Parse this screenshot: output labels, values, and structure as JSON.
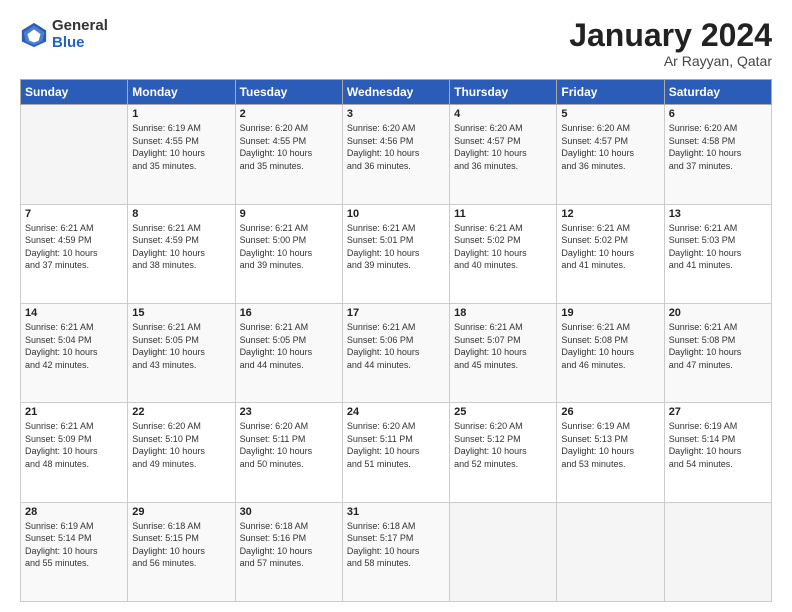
{
  "header": {
    "logo_line1": "General",
    "logo_line2": "Blue",
    "title": "January 2024",
    "subtitle": "Ar Rayyan, Qatar"
  },
  "weekdays": [
    "Sunday",
    "Monday",
    "Tuesday",
    "Wednesday",
    "Thursday",
    "Friday",
    "Saturday"
  ],
  "weeks": [
    [
      {
        "num": "",
        "info": ""
      },
      {
        "num": "1",
        "info": "Sunrise: 6:19 AM\nSunset: 4:55 PM\nDaylight: 10 hours\nand 35 minutes."
      },
      {
        "num": "2",
        "info": "Sunrise: 6:20 AM\nSunset: 4:55 PM\nDaylight: 10 hours\nand 35 minutes."
      },
      {
        "num": "3",
        "info": "Sunrise: 6:20 AM\nSunset: 4:56 PM\nDaylight: 10 hours\nand 36 minutes."
      },
      {
        "num": "4",
        "info": "Sunrise: 6:20 AM\nSunset: 4:57 PM\nDaylight: 10 hours\nand 36 minutes."
      },
      {
        "num": "5",
        "info": "Sunrise: 6:20 AM\nSunset: 4:57 PM\nDaylight: 10 hours\nand 36 minutes."
      },
      {
        "num": "6",
        "info": "Sunrise: 6:20 AM\nSunset: 4:58 PM\nDaylight: 10 hours\nand 37 minutes."
      }
    ],
    [
      {
        "num": "7",
        "info": "Sunrise: 6:21 AM\nSunset: 4:59 PM\nDaylight: 10 hours\nand 37 minutes."
      },
      {
        "num": "8",
        "info": "Sunrise: 6:21 AM\nSunset: 4:59 PM\nDaylight: 10 hours\nand 38 minutes."
      },
      {
        "num": "9",
        "info": "Sunrise: 6:21 AM\nSunset: 5:00 PM\nDaylight: 10 hours\nand 39 minutes."
      },
      {
        "num": "10",
        "info": "Sunrise: 6:21 AM\nSunset: 5:01 PM\nDaylight: 10 hours\nand 39 minutes."
      },
      {
        "num": "11",
        "info": "Sunrise: 6:21 AM\nSunset: 5:02 PM\nDaylight: 10 hours\nand 40 minutes."
      },
      {
        "num": "12",
        "info": "Sunrise: 6:21 AM\nSunset: 5:02 PM\nDaylight: 10 hours\nand 41 minutes."
      },
      {
        "num": "13",
        "info": "Sunrise: 6:21 AM\nSunset: 5:03 PM\nDaylight: 10 hours\nand 41 minutes."
      }
    ],
    [
      {
        "num": "14",
        "info": "Sunrise: 6:21 AM\nSunset: 5:04 PM\nDaylight: 10 hours\nand 42 minutes."
      },
      {
        "num": "15",
        "info": "Sunrise: 6:21 AM\nSunset: 5:05 PM\nDaylight: 10 hours\nand 43 minutes."
      },
      {
        "num": "16",
        "info": "Sunrise: 6:21 AM\nSunset: 5:05 PM\nDaylight: 10 hours\nand 44 minutes."
      },
      {
        "num": "17",
        "info": "Sunrise: 6:21 AM\nSunset: 5:06 PM\nDaylight: 10 hours\nand 44 minutes."
      },
      {
        "num": "18",
        "info": "Sunrise: 6:21 AM\nSunset: 5:07 PM\nDaylight: 10 hours\nand 45 minutes."
      },
      {
        "num": "19",
        "info": "Sunrise: 6:21 AM\nSunset: 5:08 PM\nDaylight: 10 hours\nand 46 minutes."
      },
      {
        "num": "20",
        "info": "Sunrise: 6:21 AM\nSunset: 5:08 PM\nDaylight: 10 hours\nand 47 minutes."
      }
    ],
    [
      {
        "num": "21",
        "info": "Sunrise: 6:21 AM\nSunset: 5:09 PM\nDaylight: 10 hours\nand 48 minutes."
      },
      {
        "num": "22",
        "info": "Sunrise: 6:20 AM\nSunset: 5:10 PM\nDaylight: 10 hours\nand 49 minutes."
      },
      {
        "num": "23",
        "info": "Sunrise: 6:20 AM\nSunset: 5:11 PM\nDaylight: 10 hours\nand 50 minutes."
      },
      {
        "num": "24",
        "info": "Sunrise: 6:20 AM\nSunset: 5:11 PM\nDaylight: 10 hours\nand 51 minutes."
      },
      {
        "num": "25",
        "info": "Sunrise: 6:20 AM\nSunset: 5:12 PM\nDaylight: 10 hours\nand 52 minutes."
      },
      {
        "num": "26",
        "info": "Sunrise: 6:19 AM\nSunset: 5:13 PM\nDaylight: 10 hours\nand 53 minutes."
      },
      {
        "num": "27",
        "info": "Sunrise: 6:19 AM\nSunset: 5:14 PM\nDaylight: 10 hours\nand 54 minutes."
      }
    ],
    [
      {
        "num": "28",
        "info": "Sunrise: 6:19 AM\nSunset: 5:14 PM\nDaylight: 10 hours\nand 55 minutes."
      },
      {
        "num": "29",
        "info": "Sunrise: 6:18 AM\nSunset: 5:15 PM\nDaylight: 10 hours\nand 56 minutes."
      },
      {
        "num": "30",
        "info": "Sunrise: 6:18 AM\nSunset: 5:16 PM\nDaylight: 10 hours\nand 57 minutes."
      },
      {
        "num": "31",
        "info": "Sunrise: 6:18 AM\nSunset: 5:17 PM\nDaylight: 10 hours\nand 58 minutes."
      },
      {
        "num": "",
        "info": ""
      },
      {
        "num": "",
        "info": ""
      },
      {
        "num": "",
        "info": ""
      }
    ]
  ]
}
